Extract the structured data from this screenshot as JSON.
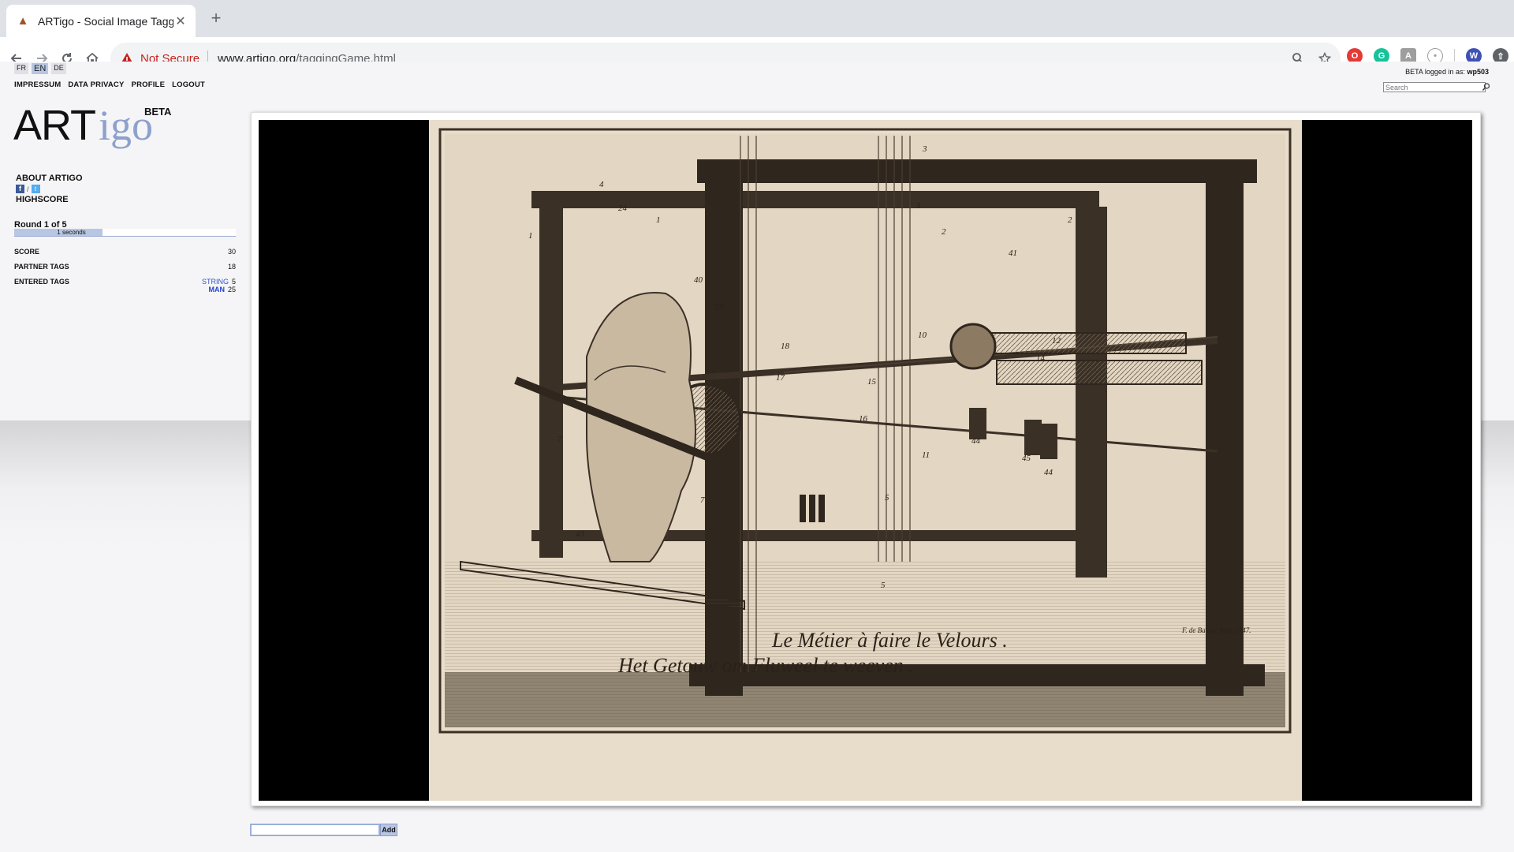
{
  "browser": {
    "tab_title": "ARTigo - Social Image Tagging",
    "security_label": "Not Secure",
    "url_host": "www.artigo.org",
    "url_path": "/taggingGame.html",
    "profile_initial": "W"
  },
  "languages": [
    "FR",
    "EN",
    "DE"
  ],
  "active_language": "EN",
  "top_nav": {
    "impressum": "IMPRESSUM",
    "data_privacy": "DATA PRIVACY",
    "profile": "PROFILE",
    "logout": "LOGOUT"
  },
  "logo": {
    "art": "ART",
    "igo": "igo",
    "beta": "BETA"
  },
  "sidebar": {
    "about": "ABOUT ARTIGO",
    "highscore": "HIGHSCORE",
    "social_separator": "/"
  },
  "round": {
    "label": "Round 1 of 5",
    "timer_text": "1 seconds",
    "timer_fraction": 0.4
  },
  "stats": {
    "score_label": "SCORE",
    "score_value": "30",
    "partner_tags_label": "PARTNER TAGS",
    "partner_tags_value": "18",
    "entered_tags_label": "ENTERED TAGS",
    "entered_tags": [
      {
        "name": "STRING",
        "count": "5"
      },
      {
        "name": "MAN",
        "count": "25"
      }
    ]
  },
  "user": {
    "prefix": "BETA logged in as:",
    "username": "wp503"
  },
  "search": {
    "placeholder": "Search"
  },
  "artwork": {
    "caption_fr": "Le Métier à faire le Velours .",
    "caption_nl": "Het Getouw om Fluweel te weeven .",
    "signature": "F. de Bakker fecit, 1747.",
    "numerals": [
      "3",
      "3",
      "24",
      "1",
      "2",
      "2",
      "1",
      "41",
      "40",
      "23",
      "18",
      "10",
      "12",
      "17",
      "15",
      "14",
      "16",
      "44",
      "45",
      "44",
      "11",
      "5",
      "5",
      "43",
      "7",
      "7",
      "4"
    ]
  },
  "tag_entry": {
    "value": "",
    "add_label": "Add"
  },
  "colors": {
    "accent_blue": "#b7c6e2",
    "logo_igo": "#8ea0cc",
    "tag_link": "#3355cc",
    "not_secure": "#c5221f"
  }
}
